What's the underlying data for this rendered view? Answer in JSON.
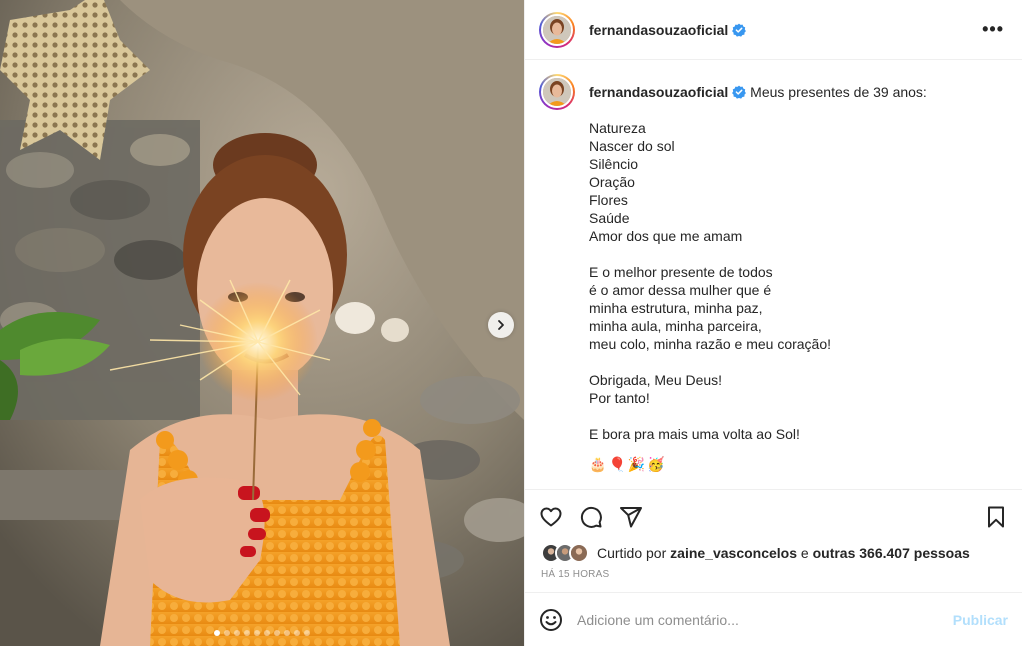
{
  "post": {
    "username": "fernandasouzaoficial",
    "more_label": "•••",
    "caption_first_line": "Meus presentes de 39 anos:",
    "caption_lines": [
      "Natureza",
      "Nascer do sol",
      "Silêncio",
      "Oração",
      "Flores",
      "Saúde",
      "Amor dos que me amam",
      "",
      "E o melhor presente de todos",
      "é o amor dessa mulher que é",
      "minha estrutura, minha paz,",
      "minha aula, minha parceira,",
      "meu colo, minha razão e meu coração!",
      "",
      "Obrigada, Meu Deus!",
      "Por tanto!",
      "",
      "E bora pra mais uma volta ao Sol!"
    ],
    "caption_emojis": [
      "🎂",
      "🎈",
      "🎉",
      "🥳"
    ],
    "likes": {
      "prefix": "Curtido por",
      "user": "zaine_vasconcelos",
      "middle": "e",
      "others": "outras 366.407 pessoas"
    },
    "time_ago": "HÁ 15 HORAS",
    "comment_placeholder": "Adicione um comentário...",
    "publish_label": "Publicar"
  },
  "carousel": {
    "total_slides": 10,
    "active_index": 0
  },
  "colors": {
    "verified": "#3897f0",
    "publish_disabled": "#b2dffc",
    "muted_text": "#8e8e8e"
  },
  "icons": [
    "verified-badge-icon",
    "more-options-icon",
    "chevron-right-icon",
    "heart-icon",
    "comment-icon",
    "share-icon",
    "bookmark-icon",
    "emoji-icon"
  ]
}
